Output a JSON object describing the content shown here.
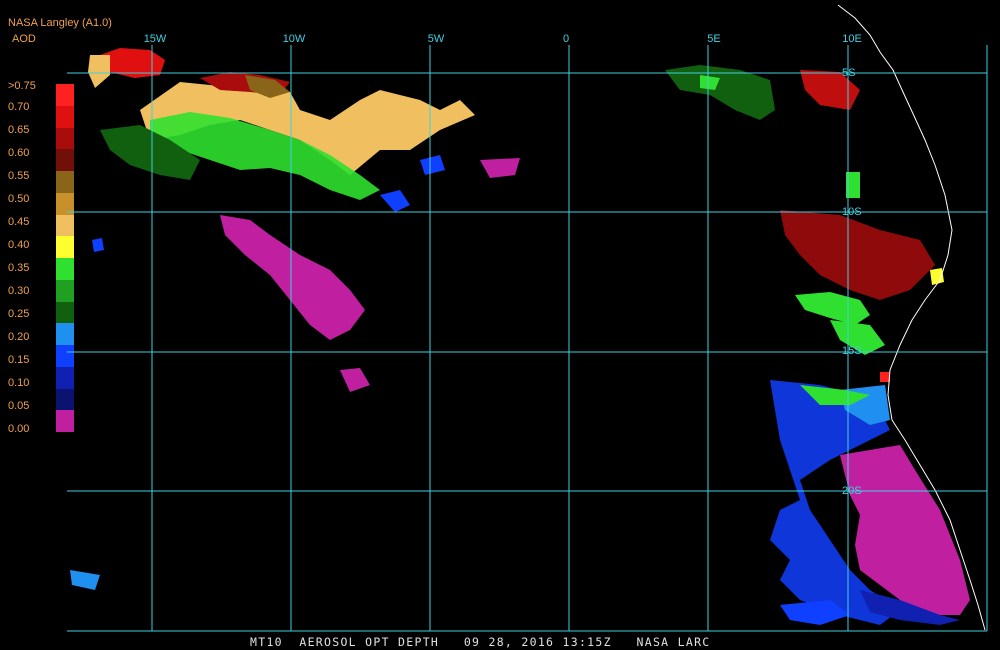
{
  "header": {
    "title": "NASA Langley (A1.0)",
    "product": "AOD"
  },
  "scale": {
    "labels": [
      ">0.75",
      "0.70",
      "0.65",
      "0.60",
      "0.55",
      "0.50",
      "0.45",
      "0.40",
      "0.35",
      "0.30",
      "0.25",
      "0.20",
      "0.15",
      "0.10",
      "0.05",
      "0.00"
    ],
    "colors": [
      "#ff2020",
      "#e01010",
      "#a80c0c",
      "#701008",
      "#8a6418",
      "#c8902a",
      "#f0c060",
      "#ffff30",
      "#30e030",
      "#20a020",
      "#106010",
      "#2090f0",
      "#1040ff",
      "#1020b0",
      "#0a1470",
      "#c020a0"
    ]
  },
  "map": {
    "longitude_labels": [
      "15W",
      "10W",
      "5W",
      "0",
      "5E",
      "10E"
    ],
    "latitude_labels": [
      "5S",
      "10S",
      "15S",
      "20S"
    ],
    "grid_color": "#40d0e0"
  },
  "footer": {
    "caption": "MT10  AEROSOL OPT DEPTH   09 28, 2016 13:15Z   NASA LARC"
  }
}
